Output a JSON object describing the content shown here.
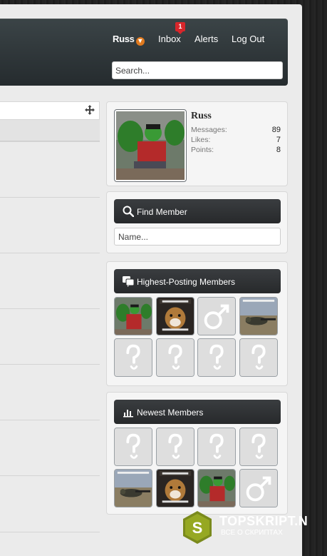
{
  "nav": {
    "username": "Russ",
    "inbox_label": "Inbox",
    "inbox_badge": "1",
    "alerts_label": "Alerts",
    "logout_label": "Log Out",
    "search_placeholder": "Search..."
  },
  "visitor": {
    "name": "Russ",
    "stats": [
      {
        "label": "Messages:",
        "value": "89"
      },
      {
        "label": "Likes:",
        "value": "7"
      },
      {
        "label": "Points:",
        "value": "8"
      }
    ]
  },
  "find_member": {
    "title": "Find Member",
    "placeholder": "Name..."
  },
  "highest_posting": {
    "title": "Highest-Posting Members",
    "avatars": [
      "hulk",
      "dog-meme",
      "male-default",
      "soldier-meme",
      "unknown",
      "unknown",
      "unknown",
      "unknown"
    ]
  },
  "newest": {
    "title": "Newest Members",
    "avatars": [
      "unknown",
      "unknown",
      "unknown",
      "unknown",
      "soldier-meme",
      "dog-meme",
      "hulk",
      "male-default"
    ]
  },
  "watermark": {
    "brand": "TOPSKRIPT.N",
    "sub": "ВСЕ О СКРИПТАХ"
  },
  "colors": {
    "accent": "#e07a1f",
    "badge": "#d7262b",
    "header_dark": "#2b3134"
  }
}
